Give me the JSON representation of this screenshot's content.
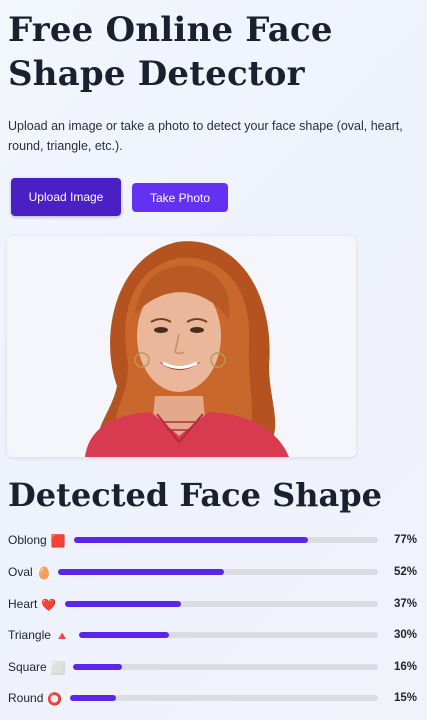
{
  "header": {
    "title": "Free Online Face Shape Detector",
    "subtitle": "Upload an image or take a photo to detect your face shape (oval, heart, round, triangle, etc.)."
  },
  "actions": {
    "upload_label": "Upload Image",
    "photo_label": "Take Photo"
  },
  "photo": {
    "description_icon": "uploaded-portrait-photo"
  },
  "results": {
    "title": "Detected Face Shape",
    "accent_color": "#5a27e6",
    "track_color": "#dcdde2",
    "items": [
      {
        "label": "Oblong",
        "emoji": "🟥",
        "percent_text": "77%",
        "value": 77
      },
      {
        "label": "Oval",
        "emoji": "🥚",
        "percent_text": "52%",
        "value": 52
      },
      {
        "label": "Heart",
        "emoji": "❤️",
        "percent_text": "37%",
        "value": 37
      },
      {
        "label": "Triangle",
        "emoji": "🔺",
        "percent_text": "30%",
        "value": 30
      },
      {
        "label": "Square",
        "emoji": "⬜",
        "percent_text": "16%",
        "value": 16
      },
      {
        "label": "Round",
        "emoji": "⭕",
        "percent_text": "15%",
        "value": 15
      }
    ]
  }
}
